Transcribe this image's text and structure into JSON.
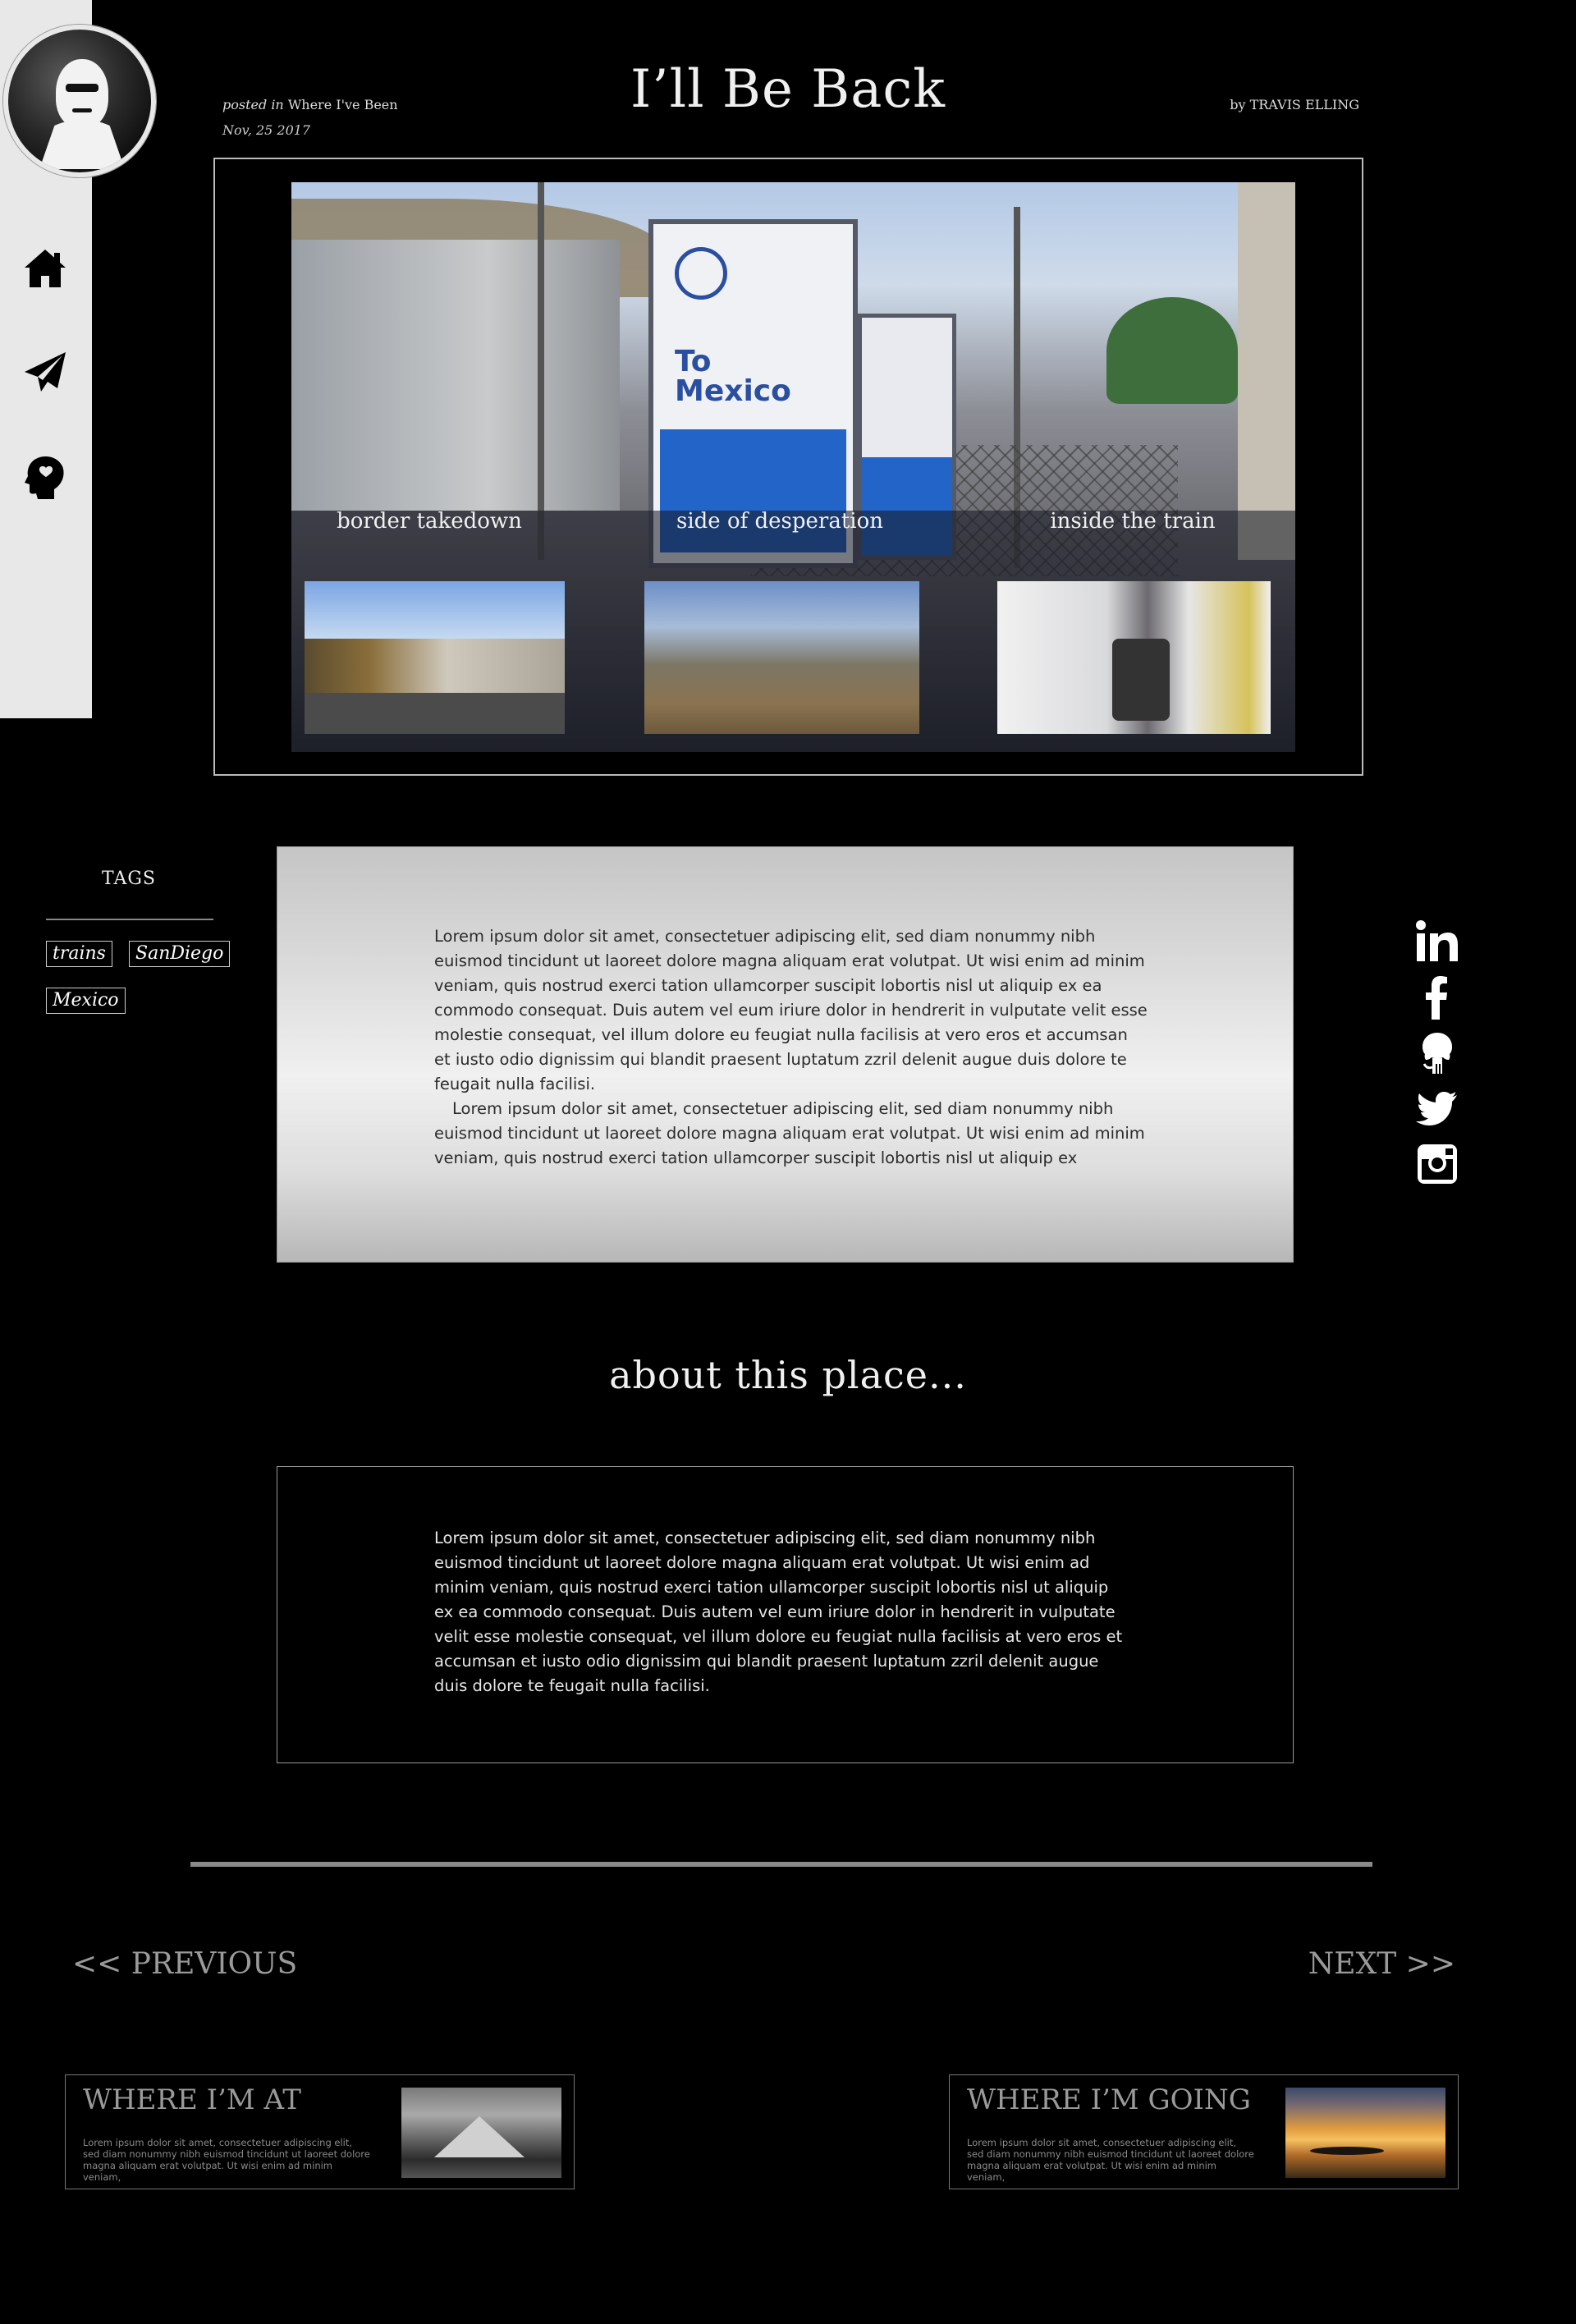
{
  "header": {
    "posted_prefix": "posted in",
    "category": "Where I've Been",
    "date": "Nov, 25 2017",
    "title": "I’ll Be Back",
    "byline": "by TRAVIS ELLING"
  },
  "sidebar": {
    "nav": [
      {
        "icon": "home-icon"
      },
      {
        "icon": "paper-plane-icon"
      },
      {
        "icon": "head-brain-icon"
      }
    ]
  },
  "hero": {
    "captions": [
      "border takedown",
      "side of desperation",
      "inside the train"
    ],
    "sign_text": "To\nMexico"
  },
  "tags": {
    "title": "TAGS",
    "items": [
      "trains",
      "SanDiego",
      "Mexico"
    ]
  },
  "article": {
    "p1": "Lorem ipsum dolor sit amet, consectetuer adipiscing elit, sed diam nonummy nibh euismod tincidunt ut laoreet dolore magna aliquam erat volutpat. Ut wisi enim ad minim veniam, quis nostrud exerci tation ullamcorper suscipit lobortis nisl ut aliquip ex ea commodo consequat. Duis autem vel eum iriure dolor in hendrerit in vulputate velit esse molestie consequat, vel illum dolore eu feugiat nulla facilisis at vero eros et accumsan et iusto odio dignissim qui blandit praesent luptatum zzril delenit augue duis dolore te feugait nulla facilisi.",
    "p2": "Lorem ipsum dolor sit amet, consectetuer adipiscing elit, sed diam nonummy nibh euismod tincidunt ut laoreet dolore magna aliquam erat volutpat. Ut wisi enim ad minim veniam, quis nostrud exerci tation ullamcorper suscipit lobortis nisl ut aliquip ex"
  },
  "social": [
    "linkedin-icon",
    "facebook-icon",
    "github-icon",
    "twitter-icon",
    "instagram-icon"
  ],
  "about": {
    "heading": "about this place...",
    "text": "Lorem ipsum dolor sit amet, consectetuer adipiscing elit, sed diam nonummy nibh euismod tincidunt ut laoreet dolore magna aliquam erat volutpat. Ut wisi enim ad minim veniam, quis nostrud exerci tation ullamcorper suscipit lobortis nisl ut aliquip ex ea commodo consequat. Duis autem vel eum iriure dolor in hendrerit in vulputate velit esse molestie consequat, vel illum dolore eu feugiat nulla facilisis at vero eros et accumsan et iusto odio dignissim qui blandit praesent luptatum zzril delenit augue duis dolore te feugait nulla facilisi."
  },
  "pagination": {
    "previous": "<< PREVIOUS",
    "next": "NEXT >>"
  },
  "cards": [
    {
      "title": "WHERE I’M AT",
      "text": "Lorem ipsum dolor sit amet, consectetuer adipiscing elit, sed diam nonummy nibh euismod tincidunt ut laoreet dolore magna aliquam erat volutpat. Ut wisi enim ad minim veniam,"
    },
    {
      "title": "WHERE I’M GOING",
      "text": "Lorem ipsum dolor sit amet, consectetuer adipiscing elit, sed diam nonummy nibh euismod tincidunt ut laoreet dolore magna aliquam erat volutpat. Ut wisi enim ad minim veniam,"
    }
  ]
}
